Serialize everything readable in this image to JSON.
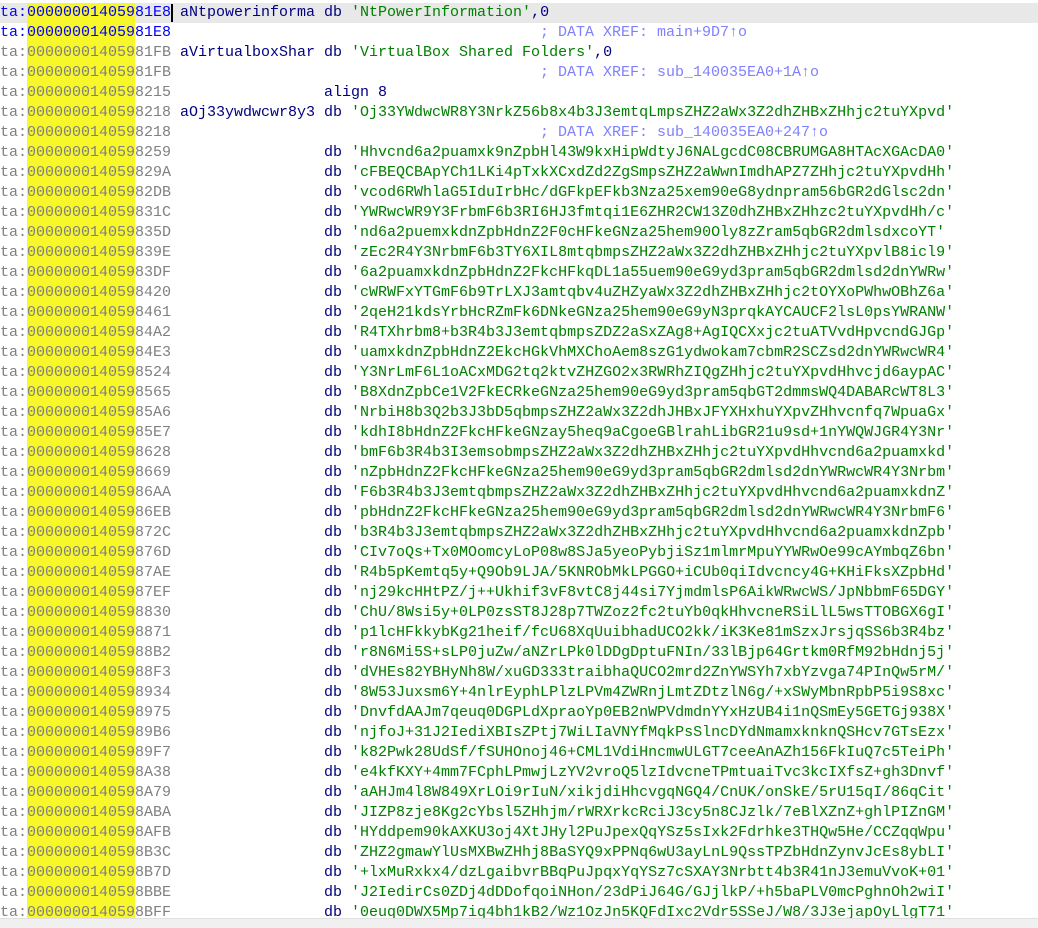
{
  "listing": {
    "lines": [
      {
        "addr": "ta:00000001405981E8",
        "name": "aNtpowerinforma",
        "op": "db",
        "operand": "'NtPowerInformation'",
        "tail": ",0",
        "comment": "",
        "current": true,
        "blue": true
      },
      {
        "addr": "ta:00000001405981E8",
        "name": "",
        "op": "",
        "operand": "",
        "tail": "",
        "comment": "; DATA XREF: main+9D7↑o",
        "blue": true
      },
      {
        "addr": "ta:00000001405981FB",
        "name": "aVirtualboxShar",
        "op": "db",
        "operand": "'VirtualBox Shared Folders'",
        "tail": ",0",
        "comment": ""
      },
      {
        "addr": "ta:00000001405981FB",
        "name": "",
        "op": "",
        "operand": "",
        "tail": "",
        "comment": "; DATA XREF: sub_140035EA0+1A↑o"
      },
      {
        "addr": "ta:0000000140598215",
        "name": "",
        "op": "align 8",
        "operand": "",
        "tail": "",
        "comment": ""
      },
      {
        "addr": "ta:0000000140598218",
        "name": "aOj33ywdwcwr8y3",
        "op": "db",
        "operand": "'Oj33YWdwcWR8Y3NrkZ56b8x4b3J3emtqLmpsZHZ2aWx3Z2dhZHBxZHhjc2tuYXpvd'",
        "tail": "",
        "comment": ""
      },
      {
        "addr": "ta:0000000140598218",
        "name": "",
        "op": "",
        "operand": "",
        "tail": "",
        "comment": "; DATA XREF: sub_140035EA0+247↑o"
      },
      {
        "addr": "ta:0000000140598259",
        "name": "",
        "op": "db",
        "operand": "'Hhvcnd6a2puamxk9nZpbHl43W9kxHipWdtyJ6NALgcdC08CBRUMGA8HTAcXGAcDA0'",
        "tail": "",
        "comment": ""
      },
      {
        "addr": "ta:000000014059829A",
        "name": "",
        "op": "db",
        "operand": "'cFBEQCBApYCh1LKi4pTxkXCxdZd2ZgSmpsZHZ2aWwnImdhAPZ7ZHhjc2tuYXpvdHh'",
        "tail": "",
        "comment": ""
      },
      {
        "addr": "ta:00000001405982DB",
        "name": "",
        "op": "db",
        "operand": "'vcod6RWhlaG5IduIrbHc/dGFkpEFkb3Nza25xem90eG8ydnpram56bGR2dGlsc2dn'",
        "tail": "",
        "comment": ""
      },
      {
        "addr": "ta:000000014059831C",
        "name": "",
        "op": "db",
        "operand": "'YWRwcWR9Y3FrbmF6b3RI6HJ3fmtqi1E6ZHR2CW13Z0dhZHBxZHhzc2tuYXpvdHh/c'",
        "tail": "",
        "comment": ""
      },
      {
        "addr": "ta:000000014059835D",
        "name": "",
        "op": "db",
        "operand": "'nd6a2puemxkdnZpbHdnZ2F0cHFkeGNza25hem90Oly8zZram5qbGR2dmlsdxcoYT'",
        "tail": "",
        "comment": ""
      },
      {
        "addr": "ta:000000014059839E",
        "name": "",
        "op": "db",
        "operand": "'zEc2R4Y3NrbmF6b3TY6XIL8mtqbmpsZHZ2aWx3Z2dhZHBxZHhjc2tuYXpvlB8icl9'",
        "tail": "",
        "comment": ""
      },
      {
        "addr": "ta:00000001405983DF",
        "name": "",
        "op": "db",
        "operand": "'6a2puamxkdnZpbHdnZ2FkcHFkqDL1a55uem90eG9yd3pram5qbGR2dmlsd2dnYWRw'",
        "tail": "",
        "comment": ""
      },
      {
        "addr": "ta:0000000140598420",
        "name": "",
        "op": "db",
        "operand": "'cWRWFxYTGmF6b9TrLXJ3amtqbv4uZHZyaWx3Z2dhZHBxZHhjc2tOYXoPWhwOBhZ6a'",
        "tail": "",
        "comment": ""
      },
      {
        "addr": "ta:0000000140598461",
        "name": "",
        "op": "db",
        "operand": "'2qeH21kdsYrbHcRZmFk6DNkeGNza25hem90eG9yN3prqkAYCAUCF2lsL0psYWRANW'",
        "tail": "",
        "comment": ""
      },
      {
        "addr": "ta:00000001405984A2",
        "name": "",
        "op": "db",
        "operand": "'R4TXhrbm8+b3R4b3J3emtqbmpsZDZ2aSxZAg8+AgIQCXxjc2tuATVvdHpvcndGJGp'",
        "tail": "",
        "comment": ""
      },
      {
        "addr": "ta:00000001405984E3",
        "name": "",
        "op": "db",
        "operand": "'uamxkdnZpbHdnZ2EkcHGkVhMXChoAem8szG1ydwokam7cbmR2SCZsd2dnYWRwcWR4'",
        "tail": "",
        "comment": ""
      },
      {
        "addr": "ta:0000000140598524",
        "name": "",
        "op": "db",
        "operand": "'Y3NrLmF6L1oACxMDG2tq2ktvZHZGO2x3RWRhZIQgZHhjc2tuYXpvdHhvcjd6aypAC'",
        "tail": "",
        "comment": ""
      },
      {
        "addr": "ta:0000000140598565",
        "name": "",
        "op": "db",
        "operand": "'B8XdnZpbCe1V2FkECRkeGNza25hem90eG9yd3pram5qbGT2dmmsWQ4DABARcWT8L3'",
        "tail": "",
        "comment": ""
      },
      {
        "addr": "ta:00000001405985A6",
        "name": "",
        "op": "db",
        "operand": "'NrbiH8b3Q2b3J3bD5qbmpsZHZ2aWx3Z2dhJHBxJFYXHxhuYXpvZHhvcnfq7WpuaGx'",
        "tail": "",
        "comment": ""
      },
      {
        "addr": "ta:00000001405985E7",
        "name": "",
        "op": "db",
        "operand": "'kdhI8bHdnZ2FkcHFkeGNzay5heq9aCgoeGBlrahLibGR21u9sd+1nYWQWJGR4Y3Nr'",
        "tail": "",
        "comment": ""
      },
      {
        "addr": "ta:0000000140598628",
        "name": "",
        "op": "db",
        "operand": "'bmF6b3R4b3I3emsobmpsZHZ2aWx3Z2dhZHBxZHhjc2tuYXpvdHhvcnd6a2puamxkd'",
        "tail": "",
        "comment": ""
      },
      {
        "addr": "ta:0000000140598669",
        "name": "",
        "op": "db",
        "operand": "'nZpbHdnZ2FkcHFkeGNza25hem90eG9yd3pram5qbGR2dmlsd2dnYWRwcWR4Y3Nrbm'",
        "tail": "",
        "comment": ""
      },
      {
        "addr": "ta:00000001405986AA",
        "name": "",
        "op": "db",
        "operand": "'F6b3R4b3J3emtqbmpsZHZ2aWx3Z2dhZHBxZHhjc2tuYXpvdHhvcnd6a2puamxkdnZ'",
        "tail": "",
        "comment": ""
      },
      {
        "addr": "ta:00000001405986EB",
        "name": "",
        "op": "db",
        "operand": "'pbHdnZ2FkcHFkeGNza25hem90eG9yd3pram5qbGR2dmlsd2dnYWRwcWR4Y3NrbmF6'",
        "tail": "",
        "comment": ""
      },
      {
        "addr": "ta:000000014059872C",
        "name": "",
        "op": "db",
        "operand": "'b3R4b3J3emtqbmpsZHZ2aWx3Z2dhZHBxZHhjc2tuYXpvdHhvcnd6a2puamxkdnZpb'",
        "tail": "",
        "comment": ""
      },
      {
        "addr": "ta:000000014059876D",
        "name": "",
        "op": "db",
        "operand": "'CIv7oQs+Tx0MOomcyLoP08w8SJa5yeoPybjiSz1mlmrMpuYYWRwOe99cAYmbqZ6bn'",
        "tail": "",
        "comment": ""
      },
      {
        "addr": "ta:00000001405987AE",
        "name": "",
        "op": "db",
        "operand": "'R4b5pKemtq5y+Q9Ob9LJA/5KNRObMkLPGGO+iCUb0qiIdvcncy4G+KHiFksXZpbHd'",
        "tail": "",
        "comment": ""
      },
      {
        "addr": "ta:00000001405987EF",
        "name": "",
        "op": "db",
        "operand": "'nj29kcHHtPZ/j++Ukhif3vF8vtC8j44si7YjmdmlsP6AikWRwcWS/JpNbbmF65DGY'",
        "tail": "",
        "comment": ""
      },
      {
        "addr": "ta:0000000140598830",
        "name": "",
        "op": "db",
        "operand": "'ChU/8Wsi5y+0LP0zsST8J28p7TWZoz2fc2tuYb0qkHhvcneRSiLlL5wsTTOBGX6gI'",
        "tail": "",
        "comment": ""
      },
      {
        "addr": "ta:0000000140598871",
        "name": "",
        "op": "db",
        "operand": "'p1lcHFkkybKg21heif/fcU68XqUuibhadUCO2kk/iK3Ke81mSzxJrsjqSS6b3R4bz'",
        "tail": "",
        "comment": ""
      },
      {
        "addr": "ta:00000001405988B2",
        "name": "",
        "op": "db",
        "operand": "'r8N6Mi5S+sLP0juZw/aNZrLPk0lDDgDptuFNIn/33lBjp64Grtkm0RfM92bHdnj5j'",
        "tail": "",
        "comment": ""
      },
      {
        "addr": "ta:00000001405988F3",
        "name": "",
        "op": "db",
        "operand": "'dVHEs82YBHyNh8W/xuGD333traibhaQUCO2mrd2ZnYWSYh7xbYzvga74PInQw5rM/'",
        "tail": "",
        "comment": ""
      },
      {
        "addr": "ta:0000000140598934",
        "name": "",
        "op": "db",
        "operand": "'8W53Juxsm6Y+4nlrEyphLPlzLPVm4ZWRnjLmtZDtzlN6g/+xSWyMbnRpbP5i9S8xc'",
        "tail": "",
        "comment": ""
      },
      {
        "addr": "ta:0000000140598975",
        "name": "",
        "op": "db",
        "operand": "'DnvfdAAJm7qeuq0DGPLdXpraoYp0EB2nWPVdmdnYYxHzUB4i1nQSmEy5GETGj938X'",
        "tail": "",
        "comment": ""
      },
      {
        "addr": "ta:00000001405989B6",
        "name": "",
        "op": "db",
        "operand": "'njfoJ+31J2IediXBIsZPtj7WiLIaVNYfMqkPsSlncDYdNmamxknknQSHcv7GTsEzx'",
        "tail": "",
        "comment": ""
      },
      {
        "addr": "ta:00000001405989F7",
        "name": "",
        "op": "db",
        "operand": "'k82Pwk28UdSf/fSUHOnoj46+CML1VdiHncmwULGT7ceeAnAZh156FkIuQ7c5TeiPh'",
        "tail": "",
        "comment": ""
      },
      {
        "addr": "ta:0000000140598A38",
        "name": "",
        "op": "db",
        "operand": "'e4kfKXY+4mm7FCphLPmwjLzYV2vroQ5lzIdvcneTPmtuaiTvc3kcIXfsZ+gh3Dnvf'",
        "tail": "",
        "comment": ""
      },
      {
        "addr": "ta:0000000140598A79",
        "name": "",
        "op": "db",
        "operand": "'aAHJm4l8W849XrLOi9rIuN/xikjdiHhcvgqNGQ4/CnUK/onSkE/5rU15qI/86qCit'",
        "tail": "",
        "comment": ""
      },
      {
        "addr": "ta:0000000140598ABA",
        "name": "",
        "op": "db",
        "operand": "'JIZP8zje8Kg2cYbsl5ZHhjm/rWRXrkcRciJ3cy5n8CJzlk/7eBlXZnZ+ghlPIZnGM'",
        "tail": "",
        "comment": ""
      },
      {
        "addr": "ta:0000000140598AFB",
        "name": "",
        "op": "db",
        "operand": "'HYddpem90kAXKU3oj4XtJHyl2PuJpexQqYSz5sIxk2Fdrhke3THQw5He/CCZqqWpu'",
        "tail": "",
        "comment": ""
      },
      {
        "addr": "ta:0000000140598B3C",
        "name": "",
        "op": "db",
        "operand": "'ZHZ2gmawYlUsMXBwZHhj8BaSYQ9xPPNq6wU3ayLnL9QssTPZbHdnZynvJcEs8ybLI'",
        "tail": "",
        "comment": ""
      },
      {
        "addr": "ta:0000000140598B7D",
        "name": "",
        "op": "db",
        "operand": "'+lxMuRxkx4/dzLgaibvrBBqPuJpqxYqYSz7cSXAY3Nrbtt4b3R41nJ3emuVvoK+01'",
        "tail": "",
        "comment": ""
      },
      {
        "addr": "ta:0000000140598BBE",
        "name": "",
        "op": "db",
        "operand": "'J2IedirCs0ZDj4dDDofqoiNHon/23dPiJ64G/GJjlkP/+h5baPLV0mcPghnOh2wiI'",
        "tail": "",
        "comment": ""
      },
      {
        "addr": "ta:0000000140598BFF",
        "name": "",
        "op": "db",
        "operand": "'0euq0DWX5Mp7iq4bh1kB2/Wz1OzJn5KQFdIxc2Vdr5SSeJ/W8/3J3ejapOyLlgT71'",
        "tail": "",
        "comment": ""
      }
    ]
  },
  "colors": {
    "highlight": "#f7f72a",
    "string": "#008000",
    "comment": "#8080ff",
    "name": "#000080",
    "address": "#808080",
    "current_address": "#0000ff"
  }
}
